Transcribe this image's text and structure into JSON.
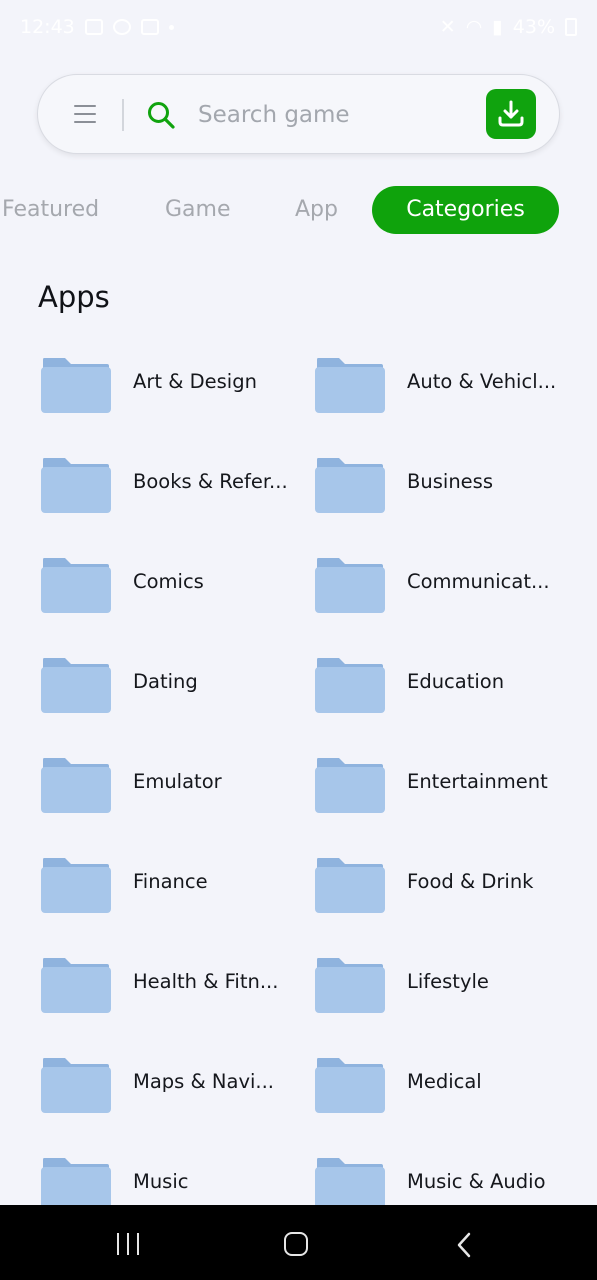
{
  "status_bar": {
    "time": "12:43",
    "battery": "43%"
  },
  "search": {
    "placeholder": "Search game"
  },
  "tabs": [
    {
      "label": "Featured"
    },
    {
      "label": "Game"
    },
    {
      "label": "App"
    },
    {
      "label": "Categories",
      "active": true
    }
  ],
  "section": {
    "title": "Apps"
  },
  "categories": [
    {
      "label": "Art & Design"
    },
    {
      "label": "Auto & Vehicl..."
    },
    {
      "label": "Books & Refer..."
    },
    {
      "label": "Business"
    },
    {
      "label": "Comics"
    },
    {
      "label": "Communicat..."
    },
    {
      "label": "Dating"
    },
    {
      "label": "Education"
    },
    {
      "label": "Emulator"
    },
    {
      "label": "Entertainment"
    },
    {
      "label": "Finance"
    },
    {
      "label": "Food & Drink"
    },
    {
      "label": "Health & Fitn..."
    },
    {
      "label": "Lifestyle"
    },
    {
      "label": "Maps & Navi..."
    },
    {
      "label": "Medical"
    },
    {
      "label": "Music"
    },
    {
      "label": "Music & Audio"
    }
  ],
  "icons": {
    "menu": "menu-icon",
    "search": "search-icon",
    "download": "download-icon",
    "folder": "folder-icon",
    "nav_recents": "recents-icon",
    "nav_home": "home-icon",
    "nav_back": "back-icon"
  },
  "colors": {
    "accent": "#0fa30c",
    "folder": "#a7c6ea",
    "background": "#f3f4fa"
  }
}
